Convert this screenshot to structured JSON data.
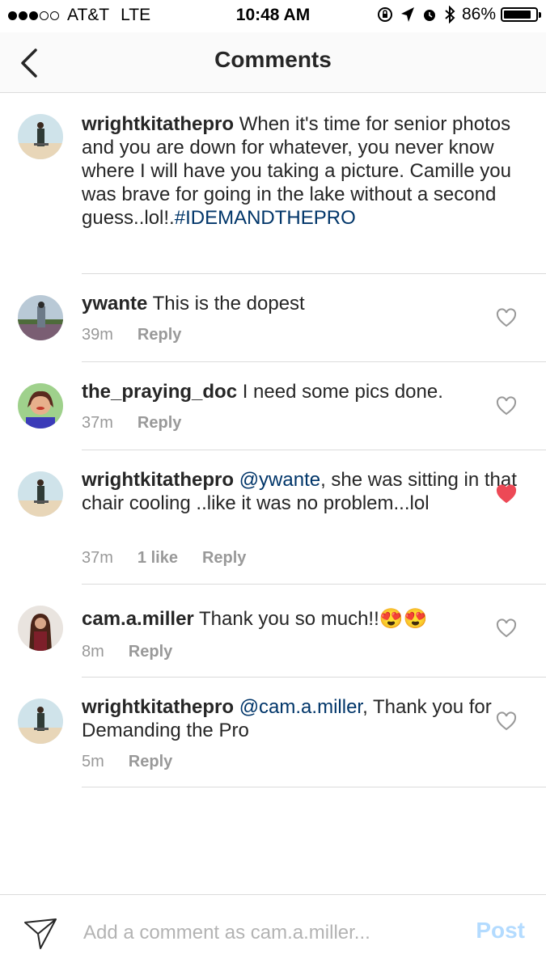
{
  "status_bar": {
    "carrier": "AT&T",
    "network": "LTE",
    "time": "10:48 AM",
    "battery_percent": "86%",
    "battery_level": 0.86,
    "signal_bars": 3
  },
  "nav": {
    "title": "Comments"
  },
  "comments": [
    {
      "username": "wrightkitathepro",
      "text": "When it's time for senior photos and you are down for whatever, you never know where I will have you taking a picture. Camille you was brave for going in the lake without a second guess..lol!.",
      "hashtag": "#IDEMANDTHEPRO"
    },
    {
      "username": "ywante",
      "text": "This is the dopest",
      "time": "39m",
      "reply_label": "Reply",
      "liked": false
    },
    {
      "username": "the_praying_doc",
      "text": "I need some pics done.",
      "time": "37m",
      "reply_label": "Reply",
      "liked": false
    },
    {
      "username": "wrightkitathepro",
      "mention": "@ywante",
      "text": ", she was sitting in that chair cooling ..like it was no problem...lol",
      "time": "37m",
      "likes_label": "1 like",
      "reply_label": "Reply",
      "liked": true
    },
    {
      "username": "cam.a.miller",
      "text": "Thank you so much!!",
      "emoji": "😍😍",
      "time": "8m",
      "reply_label": "Reply",
      "liked": false
    },
    {
      "username": "wrightkitathepro",
      "mention": "@cam.a.miller",
      "text": ", Thank you for Demanding the Pro",
      "time": "5m",
      "reply_label": "Reply",
      "liked": false
    }
  ],
  "composer": {
    "placeholder": "Add a comment as cam.a.miller...",
    "post_label": "Post"
  },
  "colors": {
    "mention": "#003569",
    "heart_liked": "#ed4956",
    "post_disabled": "#b3dbff"
  }
}
